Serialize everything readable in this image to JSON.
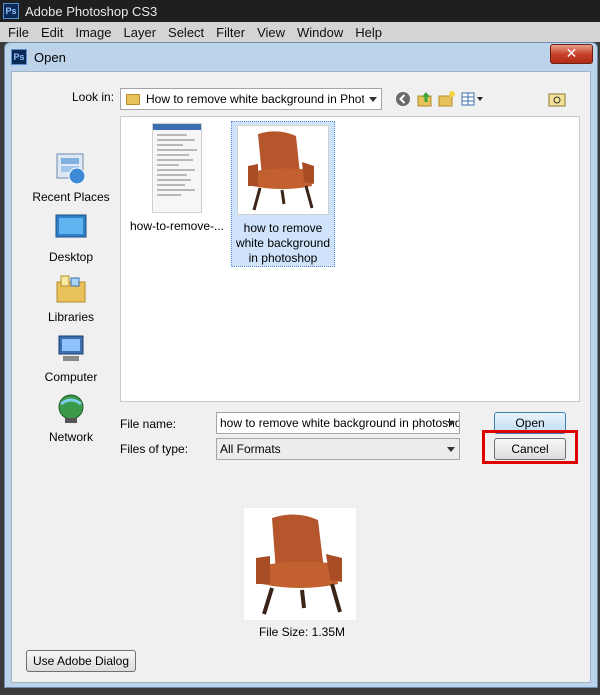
{
  "app": {
    "title": "Adobe Photoshop CS3",
    "logo_text": "Ps"
  },
  "menu": [
    "File",
    "Edit",
    "Image",
    "Layer",
    "Select",
    "Filter",
    "View",
    "Window",
    "Help"
  ],
  "dialog": {
    "title": "Open",
    "close_glyph": "✕",
    "look_in_label": "Look in:",
    "look_in_value": "How to remove white background in Photoshop",
    "places": [
      {
        "label": "Recent Places",
        "icon": "recent-places-icon"
      },
      {
        "label": "Desktop",
        "icon": "desktop-icon"
      },
      {
        "label": "Libraries",
        "icon": "libraries-icon"
      },
      {
        "label": "Computer",
        "icon": "computer-icon"
      },
      {
        "label": "Network",
        "icon": "network-icon"
      }
    ],
    "files": [
      {
        "label": "how-to-remove-...",
        "selected": false
      },
      {
        "label": "how to remove white background in photoshop",
        "selected": true
      }
    ],
    "file_name_label": "File name:",
    "file_name_value": "how to remove white background in photoshop",
    "files_of_type_label": "Files of type:",
    "files_of_type_value": "All Formats",
    "open_button": "Open",
    "cancel_button": "Cancel",
    "file_size": "File Size: 1.35M",
    "adobe_dialog_button": "Use Adobe Dialog"
  },
  "colors": {
    "highlight": "#e00000",
    "selection": "#cfe3fb",
    "chair": "#b5562c"
  }
}
